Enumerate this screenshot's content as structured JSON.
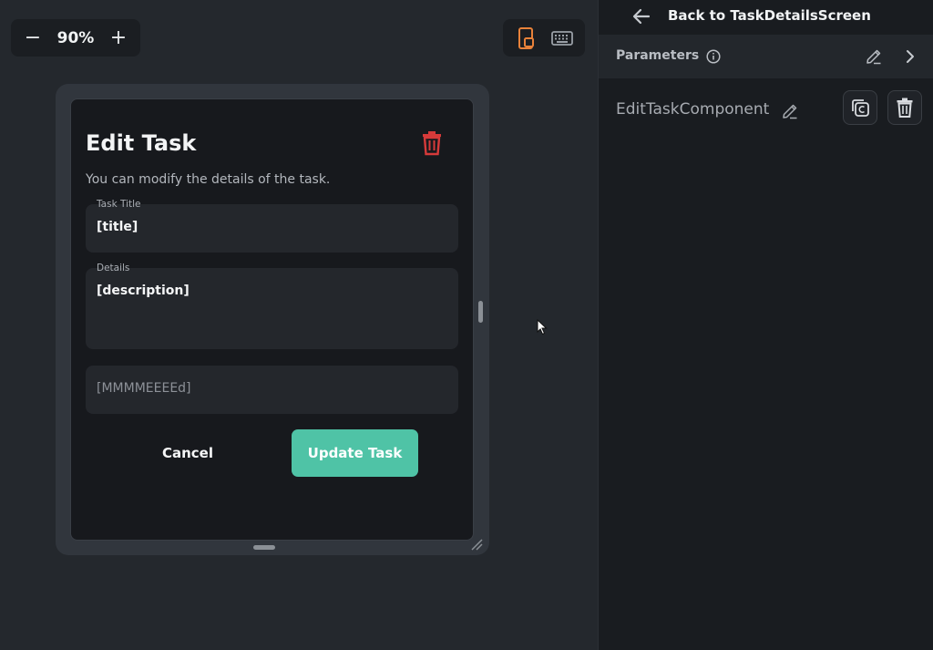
{
  "zoom": {
    "minus_symbol": "−",
    "value": "90%",
    "plus_symbol": "+"
  },
  "device_toggle": {
    "icons": [
      "phone-preview-icon",
      "keyboard-icon"
    ],
    "active_color": "#e8823a"
  },
  "dialog": {
    "title": "Edit Task",
    "subtitle": "You can modify the details of the task.",
    "fields": [
      {
        "label": "Task Title",
        "value": "[title]"
      },
      {
        "label": "Details",
        "value": "[description]"
      },
      {
        "label": "",
        "value": "[MMMMEEEEd]"
      }
    ],
    "cancel_label": "Cancel",
    "update_label": "Update Task",
    "accent_color": "#4fc3a6",
    "delete_color": "#d63a3a"
  },
  "panel": {
    "back_label": "Back to TaskDetailsScreen",
    "parameters_label": "Parameters",
    "component_name": "EditTaskComponent"
  }
}
